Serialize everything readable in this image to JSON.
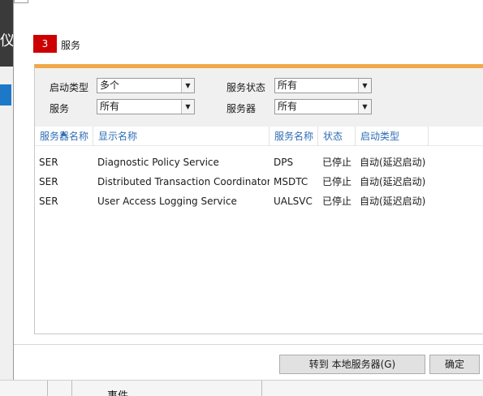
{
  "background": {
    "left_glyph": "仪",
    "bottom_label": "事件"
  },
  "section": {
    "badge": "3",
    "title": "服务"
  },
  "filters": {
    "startup_type": {
      "label": "启动类型",
      "value": "多个"
    },
    "service_status": {
      "label": "服务状态",
      "value": "所有"
    },
    "service": {
      "label": "服务",
      "value": "所有"
    },
    "server": {
      "label": "服务器",
      "value": "所有"
    }
  },
  "table": {
    "columns": [
      "服务器名称",
      "显示名称",
      "服务名称",
      "状态",
      "启动类型"
    ],
    "rows": [
      [
        "SER",
        "Diagnostic Policy Service",
        "DPS",
        "已停止",
        "自动(延迟启动)"
      ],
      [
        "SER",
        "Distributed Transaction Coordinator",
        "MSDTC",
        "已停止",
        "自动(延迟启动)"
      ],
      [
        "SER",
        "User Access Logging Service",
        "UALSVC",
        "已停止",
        "自动(延迟启动)"
      ]
    ]
  },
  "buttons": {
    "goto_local": "转到 本地服务器(G)",
    "ok": "确定"
  },
  "colors": {
    "accent_orange": "#f0a848",
    "badge_red": "#cc0000",
    "header_blue": "#2f6db5"
  }
}
